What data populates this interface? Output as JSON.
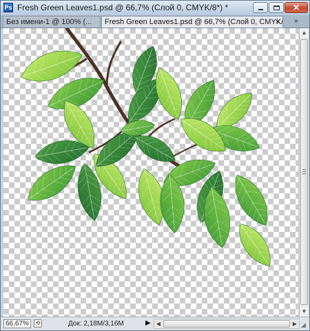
{
  "window": {
    "app_icon_text": "Ps",
    "title": "Fresh Green Leaves1.psd @ 66,7% (Слой 0, CMYK/8*) *",
    "buttons": {
      "minimize": "minimize-icon",
      "maximize": "maximize-icon",
      "close": "✕"
    }
  },
  "tabs": [
    {
      "label": "Без имени-1 @ 100% (...",
      "active": false
    },
    {
      "label": "Fresh Green Leaves1.psd @ 66,7% (Слой 0, CMYK/8*) *",
      "active": true
    }
  ],
  "tab_close_glyph": "×",
  "tab_overflow_glyph": "»",
  "canvas": {
    "content": "green-leaves-branch-image",
    "background": "transparency-checkerboard"
  },
  "statusbar": {
    "zoom": "66,67%",
    "doc_info": "Док: 2,18M/3,16M",
    "menu_arrow": "▶"
  },
  "scrollbars": {
    "up": "▲",
    "down": "▼",
    "left": "◀",
    "right": "▶"
  },
  "colors": {
    "leaf_light": "#8fd13a",
    "leaf_mid": "#4fa83a",
    "leaf_dark": "#2f7a34",
    "branch": "#4a3324",
    "title_close": "#c44a2f"
  }
}
